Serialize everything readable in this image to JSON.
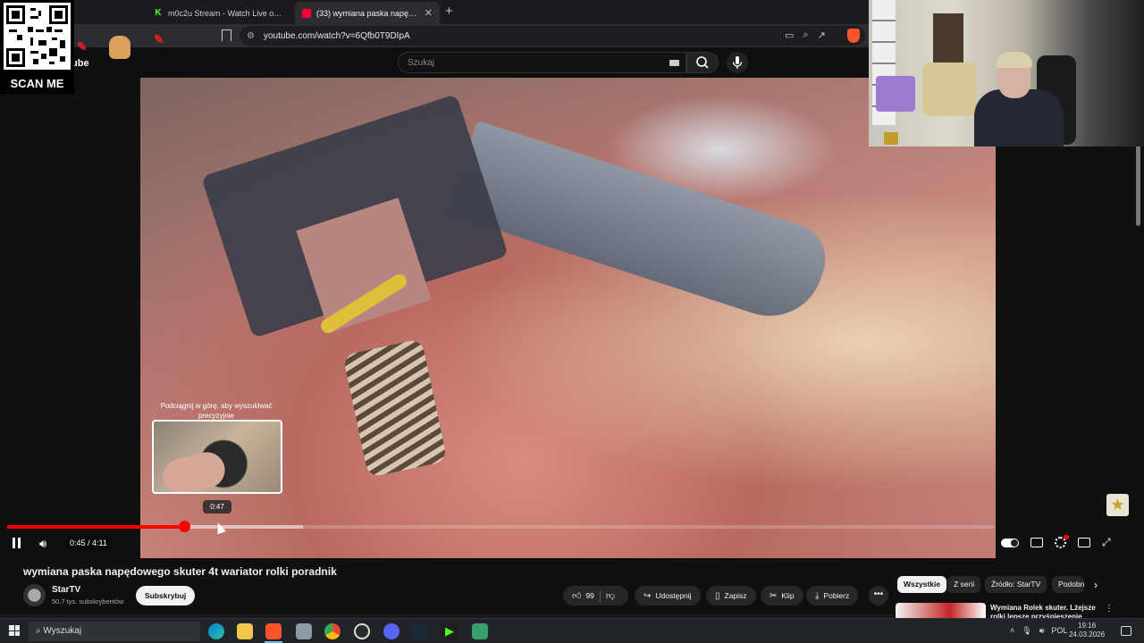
{
  "browser": {
    "tabs": [
      {
        "label": "m0c2u Stream - Watch Live on Kick",
        "favicon": "kick-icon",
        "active": false
      },
      {
        "label": "(33) wymiana paska napędowego skuter 4t wariator rolki poradnik",
        "favicon": "youtube-icon",
        "active": true,
        "audio": true
      }
    ],
    "url": "youtube.com/watch?v=6Qfb0T9DIpA"
  },
  "masthead": {
    "search_placeholder": "Szukaj"
  },
  "overlays": {
    "qr_label": "SCAN ME",
    "logo_fragment": "ube"
  },
  "player": {
    "seek_hint": "Podciągnij w górę, aby wyszukiwać precyzyjnie",
    "preview_time": "0:47",
    "time_display": "0:45 / 4:11",
    "progress_fraction": 0.179,
    "buffered_fraction": 0.3,
    "accent_color": "#ff0000"
  },
  "video": {
    "title": "wymiana paska napędowego skuter 4t wariator rolki poradnik",
    "channel": "StarTV",
    "subscribers": "50,7 tys. subskrybentów",
    "subscribe_label": "Subskrybuj",
    "likes": "99",
    "share_label": "Udostępnij",
    "save_label": "Zapisz",
    "clip_label": "Klip",
    "download_label": "Pobierz"
  },
  "sidebar": {
    "chips": [
      "Wszystkie",
      "Z serii",
      "Źródło: StarTV",
      "Podobne"
    ],
    "recommendation_title": "Wymiana Rolek skuter. Lżejsze rolki lepsze przyśpieszenie"
  },
  "taskbar": {
    "search_placeholder": "Wyszukaj",
    "language": "POL",
    "time": "19:16",
    "date": "24.03.2026"
  }
}
